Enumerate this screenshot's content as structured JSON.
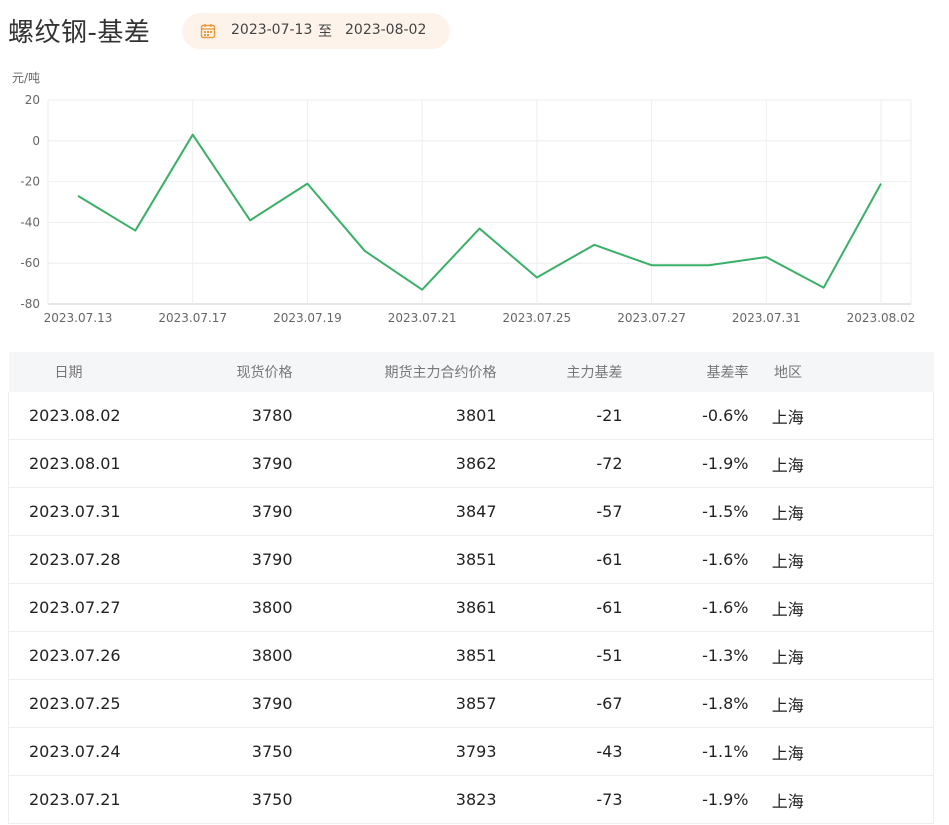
{
  "page": {
    "title": "螺纹钢-基差",
    "date_range": {
      "start": "2023-07-13",
      "separator": "至",
      "end": "2023-08-02",
      "icon": "calendar-icon"
    }
  },
  "colors": {
    "line": "#3ab067",
    "negative_text": "#3aa876",
    "pill_bg": "#fdf3ea",
    "icon": "#e89a3c"
  },
  "chart_data": {
    "type": "line",
    "ylabel": "元/吨",
    "ylim": [
      -80,
      20
    ],
    "yticks": [
      20,
      0,
      -20,
      -40,
      -60,
      -80
    ],
    "x": [
      "2023.07.13",
      "2023.07.14",
      "2023.07.17",
      "2023.07.18",
      "2023.07.19",
      "2023.07.20",
      "2023.07.21",
      "2023.07.24",
      "2023.07.25",
      "2023.07.26",
      "2023.07.27",
      "2023.07.28",
      "2023.07.31",
      "2023.08.01",
      "2023.08.02"
    ],
    "xtick_labels": [
      "2023.07.13",
      "2023.07.17",
      "2023.07.19",
      "2023.07.21",
      "2023.07.25",
      "2023.07.27",
      "2023.07.31",
      "2023.08.02"
    ],
    "series": [
      {
        "values": [
          -27,
          -44,
          3,
          -39,
          -21,
          -54,
          -73,
          -43,
          -67,
          -51,
          -61,
          -61,
          -57,
          -72,
          -21
        ]
      }
    ],
    "grid": true,
    "legend": "none"
  },
  "table": {
    "headers": {
      "date": "日期",
      "spot": "现货价格",
      "futures": "期货主力合约价格",
      "basis": "主力基差",
      "rate": "基差率",
      "region": "地区"
    },
    "rows": [
      {
        "date": "2023.08.02",
        "spot": "3780",
        "futures": "3801",
        "basis": "-21",
        "rate": "-0.6%",
        "region": "上海"
      },
      {
        "date": "2023.08.01",
        "spot": "3790",
        "futures": "3862",
        "basis": "-72",
        "rate": "-1.9%",
        "region": "上海"
      },
      {
        "date": "2023.07.31",
        "spot": "3790",
        "futures": "3847",
        "basis": "-57",
        "rate": "-1.5%",
        "region": "上海"
      },
      {
        "date": "2023.07.28",
        "spot": "3790",
        "futures": "3851",
        "basis": "-61",
        "rate": "-1.6%",
        "region": "上海"
      },
      {
        "date": "2023.07.27",
        "spot": "3800",
        "futures": "3861",
        "basis": "-61",
        "rate": "-1.6%",
        "region": "上海"
      },
      {
        "date": "2023.07.26",
        "spot": "3800",
        "futures": "3851",
        "basis": "-51",
        "rate": "-1.3%",
        "region": "上海"
      },
      {
        "date": "2023.07.25",
        "spot": "3790",
        "futures": "3857",
        "basis": "-67",
        "rate": "-1.8%",
        "region": "上海"
      },
      {
        "date": "2023.07.24",
        "spot": "3750",
        "futures": "3793",
        "basis": "-43",
        "rate": "-1.1%",
        "region": "上海"
      },
      {
        "date": "2023.07.21",
        "spot": "3750",
        "futures": "3823",
        "basis": "-73",
        "rate": "-1.9%",
        "region": "上海"
      }
    ]
  }
}
